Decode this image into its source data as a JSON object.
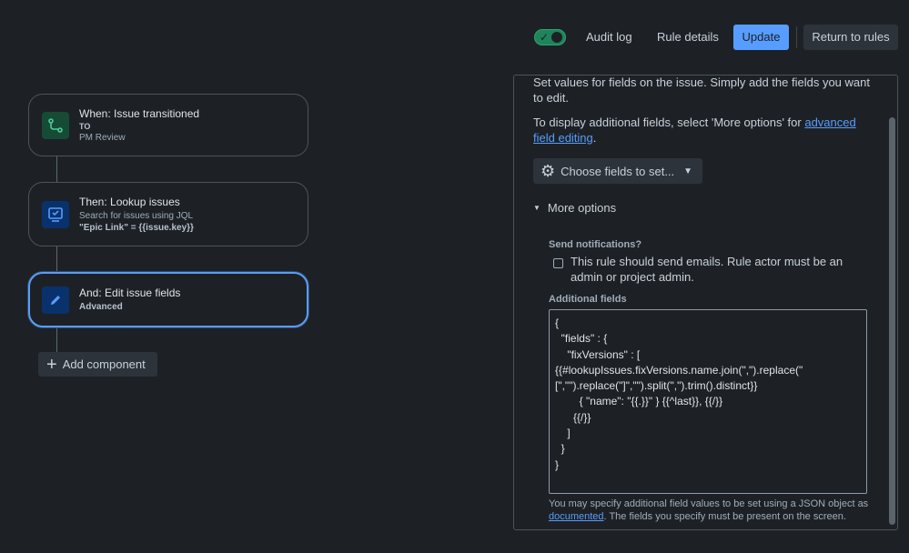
{
  "topbar": {
    "toggle_enabled": true,
    "audit_log": "Audit log",
    "rule_details": "Rule details",
    "update": "Update",
    "return_to_rules": "Return to rules"
  },
  "flow": {
    "trigger": {
      "title": "When: Issue transitioned",
      "line2": "TO",
      "line3": "PM Review"
    },
    "action1": {
      "title": "Then: Lookup issues",
      "line2": "Search for issues using JQL",
      "line3": "\"Epic Link\" = {{issue.key}}"
    },
    "action2": {
      "title": "And: Edit issue fields",
      "line2": "Advanced"
    },
    "add_component": "Add component"
  },
  "panel": {
    "intro": "Set values for fields on the issue. Simply add the fields you want to edit.",
    "display_prefix": "To display additional fields, select 'More options' for ",
    "display_link": "advanced field editing",
    "display_suffix": ".",
    "choose_fields": "Choose fields to set...",
    "more_options": "More options",
    "send_notifications_label": "Send notifications?",
    "send_notifications_text": "This rule should send emails. Rule actor must be an admin or project admin.",
    "additional_fields_label": "Additional fields",
    "json_value": "{\n  \"fields\" : {\n    \"fixVersions\" : [\n{{#lookupIssues.fixVersions.name.join(\",\").replace(\"\n[\",\"\").replace(\"]\",\"\").split(\",\").trim().distinct}}\n        { \"name\": \"{{.}}\" } {{^last}}, {{/}}\n      {{/}}\n    ]\n  }\n}",
    "help_prefix": "You may specify additional field values to be set using a JSON object as ",
    "help_link": "documented",
    "help_suffix": ". The fields you specify must be present on the screen."
  },
  "colors": {
    "accent": "#579dff",
    "toggle_on": "#1f845a",
    "background": "#1d2125"
  }
}
